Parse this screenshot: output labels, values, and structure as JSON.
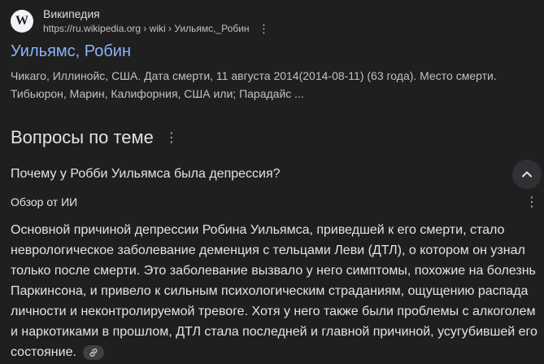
{
  "result": {
    "favicon_letter": "W",
    "site_name": "Википедия",
    "url": "https://ru.wikipedia.org › wiki › Уильямс,_Робин",
    "title": "Уильямс, Робин",
    "snippet": "Чикаго, Иллинойс, США. Дата смерти, 11 августа 2014(2014-08-11) (63 года). Место смерти. Тибьюрон, Марин, Калифорния, США или; Парадайс ..."
  },
  "questions": {
    "title": "Вопросы по теме",
    "question": "Почему у Робби Уильямса была депрессия?",
    "ai_label": "Обзор от ИИ",
    "answer": "Основной причиной депрессии Робина Уильямса, приведшей к его смерти, стало неврологическое заболевание деменция с тельцами Леви (ДТЛ), о котором он узнал только после смерти. Это заболевание вызвало у него симптомы, похожие на болезнь Паркинсона, и привело к сильным психологическим страданиям, ощущению распада личности и неконтролируемой тревоге. Хотя у него также были проблемы с алкоголем и наркотиками в прошлом, ДТЛ стала последней и главной причиной, усугубившей его состояние."
  },
  "icons": {
    "kebab": "⋮"
  }
}
